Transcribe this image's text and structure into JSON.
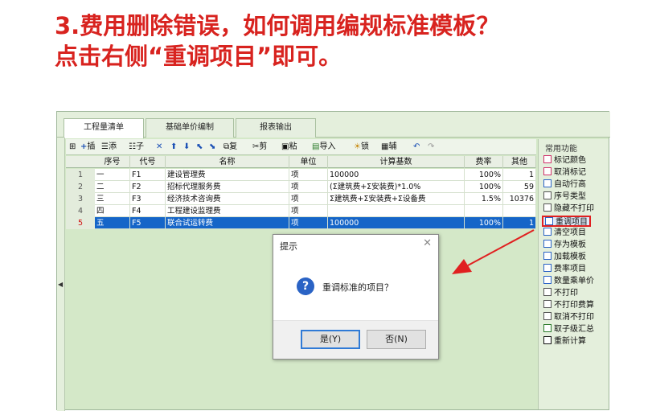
{
  "headline": {
    "line1": "3.费用删除错误，如何调用编规标准模板？",
    "line2": "点击右侧“重调项目”即可。"
  },
  "tabs": [
    {
      "label": "工程量清单",
      "active": true
    },
    {
      "label": "基础单价编制",
      "active": false
    },
    {
      "label": "报表输出",
      "active": false
    }
  ],
  "toolbar": {
    "insert": "插",
    "add": "添",
    "child": "子",
    "copy": "复",
    "cut": "剪",
    "paste": "粘",
    "import": "导入",
    "lock": "锁",
    "aux": "辅"
  },
  "grid": {
    "columns": [
      "序号",
      "代号",
      "名称",
      "单位",
      "计算基数",
      "费率",
      "其他"
    ],
    "rows": [
      {
        "num": "1",
        "seq": "一",
        "code": "F1",
        "name": "建设管理费",
        "unit": "项",
        "base": "100000",
        "rate": "100%",
        "other": "1",
        "selected": false
      },
      {
        "num": "2",
        "seq": "二",
        "code": "F2",
        "name": "招标代理服务费",
        "unit": "项",
        "base": "(Σ建筑费+Σ安装费)*1.0%",
        "rate": "100%",
        "other": "59",
        "selected": false
      },
      {
        "num": "3",
        "seq": "三",
        "code": "F3",
        "name": "经济技术咨询费",
        "unit": "项",
        "base": "Σ建筑费+Σ安装费+Σ设备费",
        "rate": "1.5%",
        "other": "10376",
        "selected": false
      },
      {
        "num": "4",
        "seq": "四",
        "code": "F4",
        "name": "工程建设监理费",
        "unit": "项",
        "base": "",
        "rate": "",
        "other": "",
        "selected": false
      },
      {
        "num": "5",
        "seq": "五",
        "code": "F5",
        "name": "联合试运转费",
        "unit": "项",
        "base": "100000",
        "rate": "100%",
        "other": "1",
        "selected": true
      }
    ]
  },
  "right_panel": {
    "title": "常用功能",
    "items": [
      {
        "label": "标记颜色",
        "icon": "color-icon",
        "highlighted": false
      },
      {
        "label": "取消标记",
        "icon": "unmark-icon",
        "highlighted": false
      },
      {
        "label": "自动行高",
        "icon": "row-height-icon",
        "highlighted": false
      },
      {
        "label": "序号类型",
        "icon": "numbering-icon",
        "highlighted": false
      },
      {
        "label": "隐藏不打印",
        "icon": "hide-icon",
        "highlighted": false
      },
      {
        "label": "重调项目",
        "icon": "reload-icon",
        "highlighted": true
      },
      {
        "label": "清空项目",
        "icon": "clear-icon",
        "highlighted": false
      },
      {
        "label": "存为模板",
        "icon": "save-template-icon",
        "highlighted": false
      },
      {
        "label": "加载模板",
        "icon": "load-template-icon",
        "highlighted": false
      },
      {
        "label": "费率项目",
        "icon": "rate-icon",
        "highlighted": false
      },
      {
        "label": "数量乘单价",
        "icon": "multiply-icon",
        "highlighted": false
      },
      {
        "label": "不打印",
        "icon": "no-print-icon",
        "highlighted": false
      },
      {
        "label": "不打印费算",
        "icon": "no-print-calc-icon",
        "highlighted": false
      },
      {
        "label": "取消不打印",
        "icon": "cancel-no-print-icon",
        "highlighted": false
      },
      {
        "label": "取子级汇总",
        "icon": "home-icon",
        "highlighted": false
      },
      {
        "label": "重新计算",
        "icon": "sigma-icon",
        "highlighted": false
      }
    ]
  },
  "dialog": {
    "title": "提示",
    "message": "重调标准的项目？",
    "yes": "是(Y)",
    "no": "否(N)"
  },
  "colors": {
    "headline": "#d8231f",
    "selected_row": "#1565c8",
    "highlight_border": "#e02020",
    "app_background": "#d4e8c8"
  }
}
